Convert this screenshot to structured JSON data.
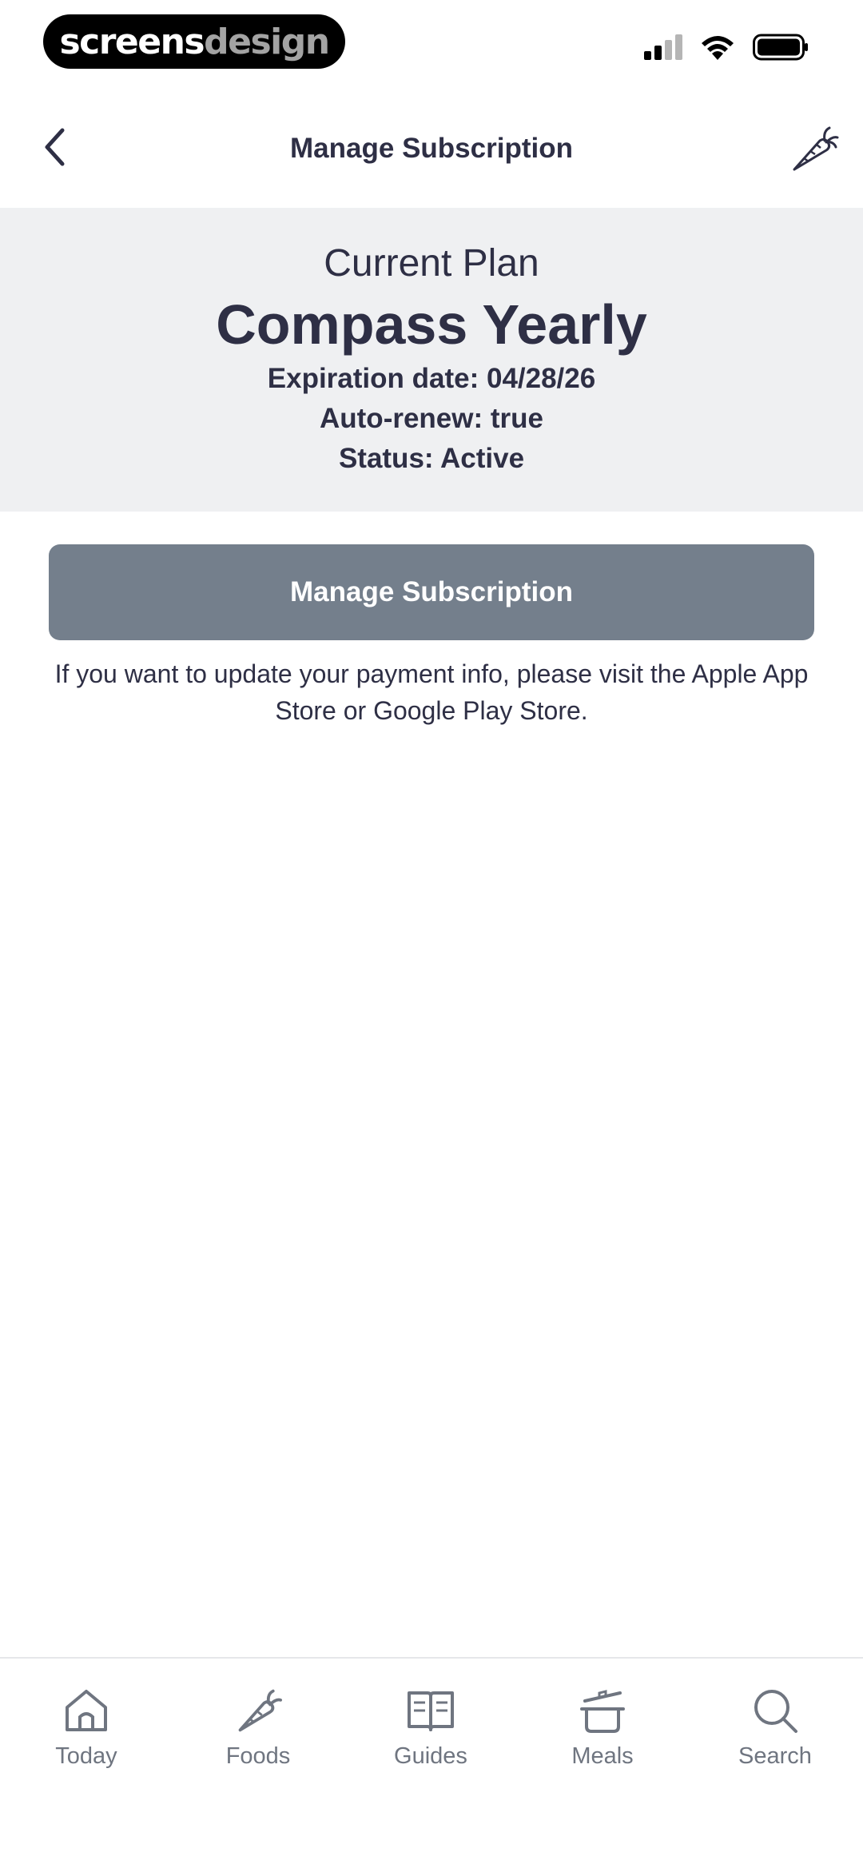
{
  "status_bar": {
    "brand_part1": "screens",
    "brand_part2": "design"
  },
  "nav": {
    "title": "Manage Subscription"
  },
  "plan": {
    "label": "Current Plan",
    "name": "Compass Yearly",
    "expiration": "Expiration date: 04/28/26",
    "auto_renew": "Auto-renew: true",
    "status": "Status: Active"
  },
  "actions": {
    "manage_button": "Manage Subscription",
    "info_text": "If you want to update your payment info, please visit the Apple App Store or Google Play Store."
  },
  "tabs": [
    {
      "label": "Today",
      "icon": "home-icon"
    },
    {
      "label": "Foods",
      "icon": "carrot-icon"
    },
    {
      "label": "Guides",
      "icon": "book-icon"
    },
    {
      "label": "Meals",
      "icon": "pot-icon"
    },
    {
      "label": "Search",
      "icon": "search-icon"
    }
  ],
  "colors": {
    "text": "#2e2f45",
    "card_bg": "#eff0f2",
    "button_bg": "#747f8c",
    "tab_text": "#6f7580"
  }
}
